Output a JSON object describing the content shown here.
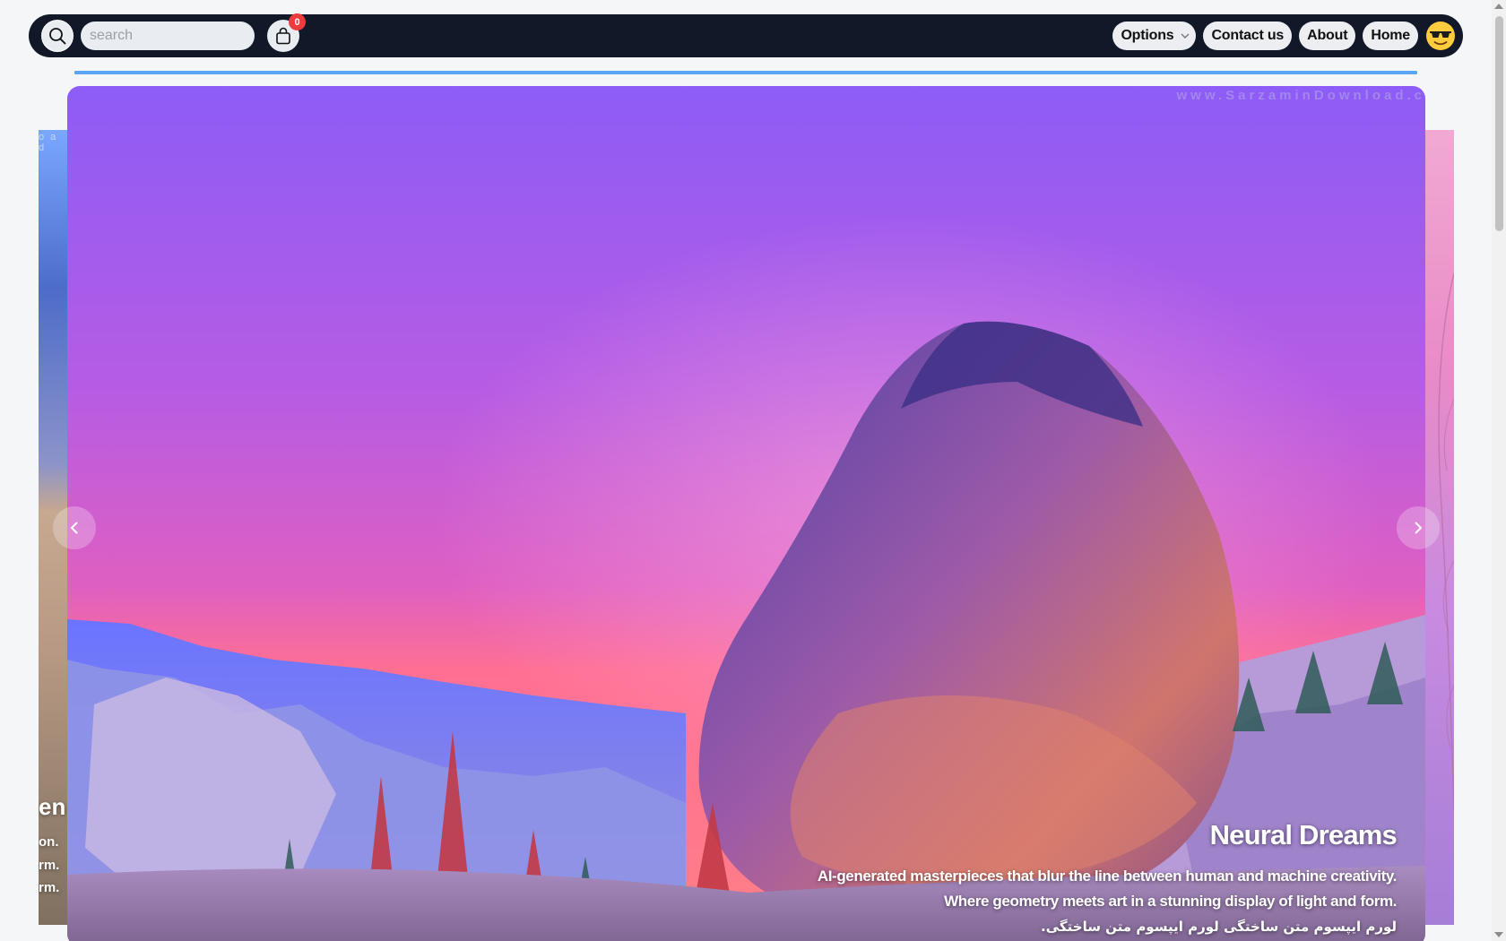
{
  "navbar": {
    "search": {
      "placeholder": "search",
      "value": ""
    },
    "cart": {
      "count": "0"
    },
    "options_label": "Options",
    "contact_label": "Contact us",
    "about_label": "About",
    "home_label": "Home",
    "avatar": "😎"
  },
  "progress": {
    "fill_percent": 100
  },
  "carousel": {
    "prev_slide_peek": {
      "title_fragment": "en",
      "lines": [
        "on.",
        "rm.",
        "rm."
      ],
      "watermark_fragment": "o a d"
    },
    "active_slide": {
      "title": "Neural Dreams",
      "line1": "AI-generated masterpieces that blur the line between human and machine creativity.",
      "line2": "Where geometry meets art in a stunning display of light and form.",
      "line3": "لورم ایپسوم متن ساختگی لورم ایپسوم متن ساختگی.",
      "watermark": "www.SarzaminDownload.c"
    }
  },
  "colors": {
    "navbar": "#111827",
    "accent": "#5aa6f4",
    "badge": "#ef3b3b"
  },
  "icons": [
    "search-icon",
    "shopping-bag-icon",
    "chevron-down-icon",
    "chevron-left-icon",
    "chevron-right-icon",
    "sunglasses-emoji-avatar"
  ]
}
